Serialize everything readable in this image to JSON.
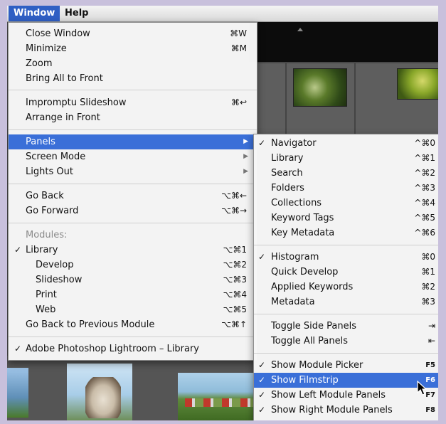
{
  "menubar": {
    "window": "Window",
    "help": "Help"
  },
  "window_menu": {
    "close": {
      "label": "Close Window",
      "shortcut": "⌘W"
    },
    "minimize": {
      "label": "Minimize",
      "shortcut": "⌘M"
    },
    "zoom": {
      "label": "Zoom"
    },
    "bring_all": {
      "label": "Bring All to Front"
    },
    "impromptu": {
      "label": "Impromptu Slideshow",
      "shortcut": "⌘↩"
    },
    "arrange": {
      "label": "Arrange in Front"
    },
    "panels": {
      "label": "Panels"
    },
    "screen_mode": {
      "label": "Screen Mode"
    },
    "lights_out": {
      "label": "Lights Out"
    },
    "go_back": {
      "label": "Go Back",
      "shortcut": "⌥⌘←"
    },
    "go_forward": {
      "label": "Go Forward",
      "shortcut": "⌥⌘→"
    },
    "modules_header": "Modules:",
    "library": {
      "label": "Library",
      "shortcut": "⌥⌘1",
      "checked": "✓"
    },
    "develop": {
      "label": "Develop",
      "shortcut": "⌥⌘2"
    },
    "slideshow": {
      "label": "Slideshow",
      "shortcut": "⌥⌘3"
    },
    "print": {
      "label": "Print",
      "shortcut": "⌥⌘4"
    },
    "web": {
      "label": "Web",
      "shortcut": "⌥⌘5"
    },
    "go_back_module": {
      "label": "Go Back to Previous Module",
      "shortcut": "⌥⌘↑"
    },
    "lightroom": {
      "label": "Adobe Photoshop Lightroom – Library",
      "checked": "✓"
    }
  },
  "panels_menu": {
    "navigator": {
      "label": "Navigator",
      "shortcut": "^⌘0",
      "checked": "✓"
    },
    "library": {
      "label": "Library",
      "shortcut": "^⌘1"
    },
    "search": {
      "label": "Search",
      "shortcut": "^⌘2"
    },
    "folders": {
      "label": "Folders",
      "shortcut": "^⌘3"
    },
    "collections": {
      "label": "Collections",
      "shortcut": "^⌘4"
    },
    "keyword_tags": {
      "label": "Keyword Tags",
      "shortcut": "^⌘5"
    },
    "key_metadata": {
      "label": "Key Metadata",
      "shortcut": "^⌘6"
    },
    "histogram": {
      "label": "Histogram",
      "shortcut": "⌘0",
      "checked": "✓"
    },
    "quick_develop": {
      "label": "Quick Develop",
      "shortcut": "⌘1"
    },
    "applied_keywords": {
      "label": "Applied Keywords",
      "shortcut": "⌘2"
    },
    "metadata": {
      "label": "Metadata",
      "shortcut": "⌘3"
    },
    "toggle_side": {
      "label": "Toggle Side Panels",
      "shortcut": "⇥"
    },
    "toggle_all": {
      "label": "Toggle All Panels",
      "shortcut": "⇤"
    },
    "module_picker": {
      "label": "Show Module Picker",
      "shortcut": "F5",
      "checked": "✓"
    },
    "filmstrip": {
      "label": "Show Filmstrip",
      "shortcut": "F6",
      "checked": "✓"
    },
    "left_module": {
      "label": "Show Left Module Panels",
      "shortcut": "F7",
      "checked": "✓"
    },
    "right_module": {
      "label": "Show Right Module Panels",
      "shortcut": "F8",
      "checked": "✓"
    }
  },
  "colors": {
    "highlight": "#3a6fd8",
    "menubar_selected": "#2f5fc4",
    "menu_bg": "#f6f6f6"
  }
}
